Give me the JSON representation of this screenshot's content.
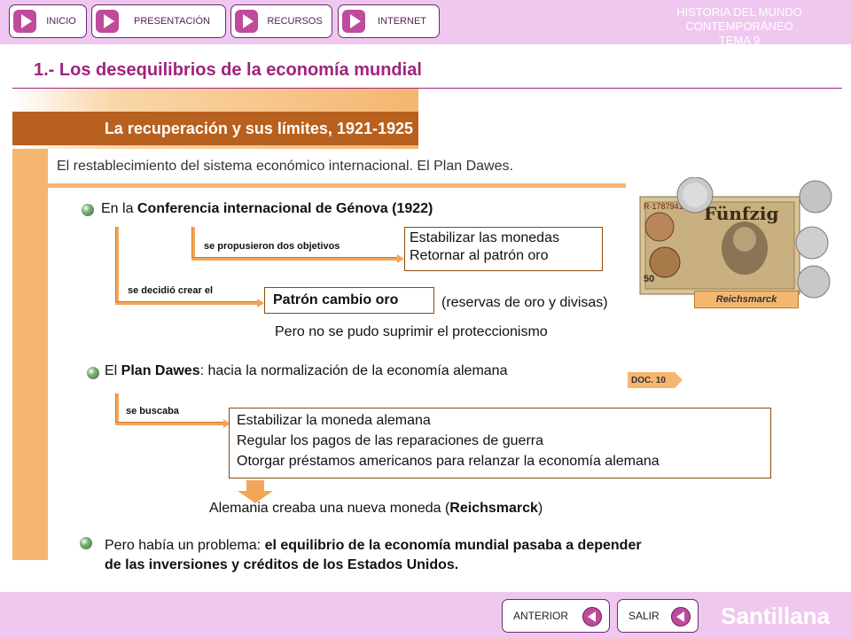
{
  "nav": {
    "items": [
      {
        "label": "INICIO"
      },
      {
        "label": "PRESENTACIÓN"
      },
      {
        "label": "RECURSOS"
      },
      {
        "label": "INTERNET"
      }
    ],
    "header_line1": "HISTORIA DEL MUNDO CONTEMPORÁNEO",
    "header_line2": "TEMA 9"
  },
  "section_title": "1.- Los desequilibrios de la economía mundial",
  "subtitle": "La recuperación y sus límites, 1921-1925",
  "intro": "El restablecimiento del sistema económico internacional. El Plan Dawes.",
  "genova": {
    "prefix": "En la ",
    "bold": "Conferencia internacional de Génova (1922)",
    "label_objectives": "se propusieron dos objetivos",
    "objectives": [
      "Estabilizar las monedas",
      "Retornar al patrón oro"
    ],
    "label_create": "se decidió crear el",
    "patron": "Patrón cambio oro",
    "reservas": "(reservas de oro y divisas)",
    "proteccionismo": "Pero no se pudo suprimir el proteccionismo"
  },
  "image": {
    "caption": "Reichsmarck",
    "serial": "R·1787941",
    "note_text": "Fünfzig",
    "denomination": "50"
  },
  "dawes": {
    "prefix": "El ",
    "bold": "Plan Dawes",
    "suffix": ": hacia la normalización de la economía alemana",
    "doc": "DOC. 10",
    "label_buscaba": "se buscaba",
    "goals": [
      "Estabilizar la moneda alemana",
      "Regular los pagos de las reparaciones de guerra",
      "Otorgar préstamos americanos para relanzar la economía alemana"
    ],
    "result_prefix": "Alemania creaba una nueva moneda (",
    "result_bold": "Reichsmarck",
    "result_suffix": ")"
  },
  "problem": {
    "prefix": "Pero había un problema: ",
    "bold_line1": "el equilibrio de la economía mundial pasaba a depender",
    "bold_line2": "de las inversiones y créditos de los Estados Unidos."
  },
  "footer": {
    "anterior": "ANTERIOR",
    "salir": "SALIR",
    "brand": "Santillana"
  },
  "colors": {
    "accent": "#a0237e",
    "band": "#f5b670",
    "subtitle_bg": "#b8601e",
    "bar_bg": "#efc8ef"
  }
}
